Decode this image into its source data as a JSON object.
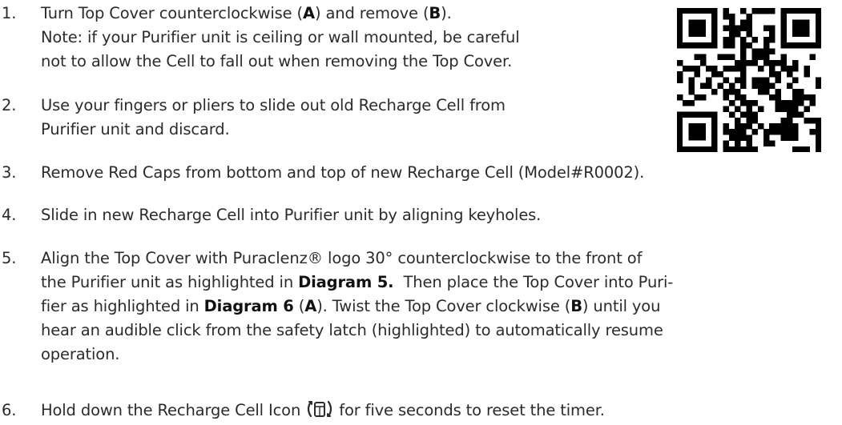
{
  "steps": [
    {
      "number": "1.",
      "lines": [
        [
          "Turn Top Cover counterclockwise (",
          {
            "b": "A"
          },
          ") and remove (",
          {
            "b": "B"
          },
          ")."
        ],
        [
          "Note: if your Purifier unit is ceiling or wall mounted, be careful"
        ],
        [
          "not to allow the Cell to fall out when removing the Top Cover."
        ]
      ]
    },
    {
      "number": "2.",
      "lines": [
        [
          "Use your fingers or pliers to slide out old Recharge Cell from"
        ],
        [
          "Purifier unit and discard."
        ]
      ]
    },
    {
      "number": "3.",
      "lines": [
        [
          "Remove Red Caps from bottom and top of new Recharge Cell (Model#R0002)."
        ]
      ]
    },
    {
      "number": "4.",
      "lines": [
        [
          "Slide in new Recharge Cell into Purifier unit by aligning keyholes."
        ]
      ]
    },
    {
      "number": "5.",
      "lines": [
        [
          "Align the Top Cover with Puraclenz® logo 30° counterclockwise to the front of"
        ],
        [
          "the Purifier unit as highlighted in ",
          {
            "b": "Diagram 5."
          },
          "  Then place the Top Cover into Puri-"
        ],
        [
          "fier as highlighted in ",
          {
            "b": "Diagram 6"
          },
          " (",
          {
            "b": "A"
          },
          "). Twist the Top Cover clockwise (",
          {
            "b": "B"
          },
          ") until you"
        ],
        [
          "hear an audible click from the safety latch (highlighted) to automatically resume"
        ],
        [
          "operation."
        ]
      ]
    },
    {
      "number": "6.",
      "lines": [
        [
          "Hold down the Recharge Cell Icon ",
          {
            "icon": "recharge-cell-icon"
          },
          " for five seconds to reset the timer."
        ]
      ]
    }
  ],
  "qr_code": {
    "icon": "qr-code-icon"
  }
}
